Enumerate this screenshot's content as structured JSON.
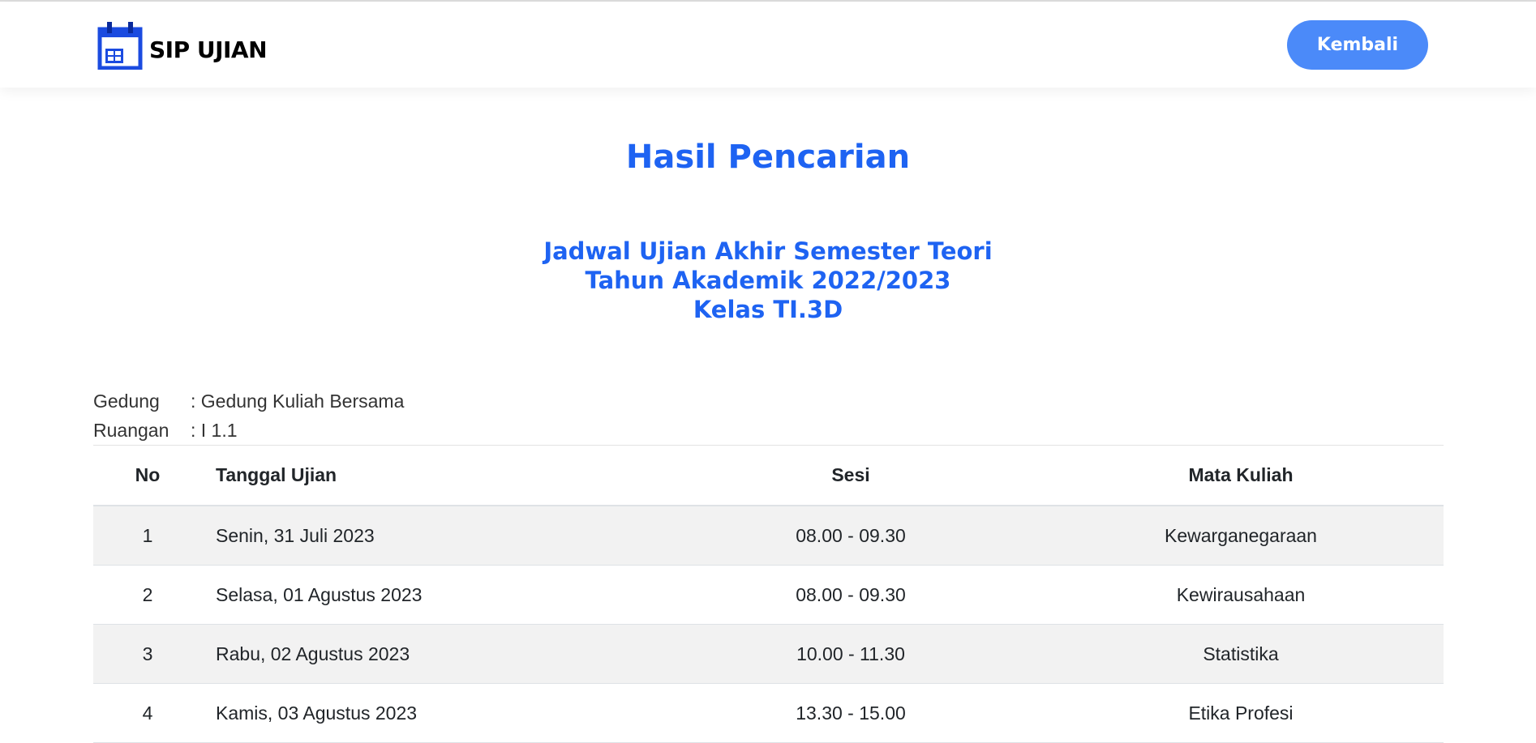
{
  "header": {
    "brand": "SIP UJIAN",
    "back_button": "Kembali"
  },
  "page": {
    "title": "Hasil Pencarian",
    "subtitle_lines": [
      "Jadwal Ujian Akhir Semester Teori",
      "Tahun Akademik 2022/2023",
      "Kelas TI.3D"
    ]
  },
  "info": {
    "gedung_label": "Gedung",
    "gedung_value": ": Gedung Kuliah Bersama",
    "ruangan_label": "Ruangan",
    "ruangan_value": ": I 1.1"
  },
  "table": {
    "headers": [
      "No",
      "Tanggal Ujian",
      "Sesi",
      "Mata Kuliah"
    ],
    "rows": [
      [
        "1",
        "Senin, 31 Juli 2023",
        "08.00 - 09.30",
        "Kewarganegaraan"
      ],
      [
        "2",
        "Selasa, 01 Agustus 2023",
        "08.00 - 09.30",
        "Kewirausahaan"
      ],
      [
        "3",
        "Rabu, 02 Agustus 2023",
        "10.00 - 11.30",
        "Statistika"
      ],
      [
        "4",
        "Kamis, 03 Agustus 2023",
        "13.30 - 15.00",
        "Etika Profesi"
      ]
    ]
  },
  "colors": {
    "accent": "#1e63f2",
    "button": "#4b8af9",
    "brand_icon": "#1b4be0"
  },
  "icons": {
    "brand": "calendar-icon"
  }
}
